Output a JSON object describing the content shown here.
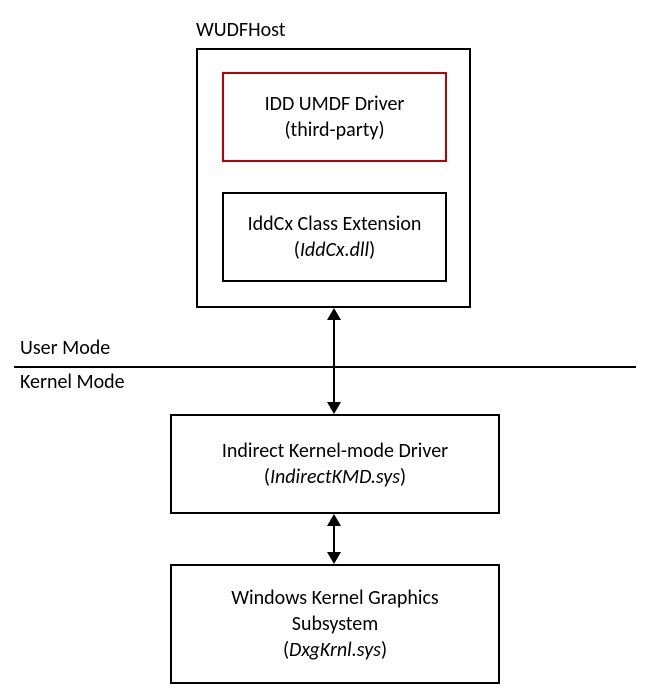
{
  "outer": {
    "title": "WUDFHost"
  },
  "idd": {
    "line1": "IDD UMDF Driver",
    "line2": "(third-party)"
  },
  "iddcx": {
    "line1": "IddCx Class Extension",
    "line2_prefix": "(",
    "line2_italic": "IddCx.dll",
    "line2_suffix": ")"
  },
  "mode": {
    "user": "User Mode",
    "kernel": "Kernel Mode"
  },
  "ikmd": {
    "line1": "Indirect Kernel-mode Driver",
    "line2_prefix": "(",
    "line2_italic": "IndirectKMD.sys",
    "line2_suffix": ")"
  },
  "dxg": {
    "line1": "Windows Kernel Graphics",
    "line2": "Subsystem",
    "line3_prefix": "(",
    "line3_italic": "DxgKrnl.sys",
    "line3_suffix": ")"
  }
}
